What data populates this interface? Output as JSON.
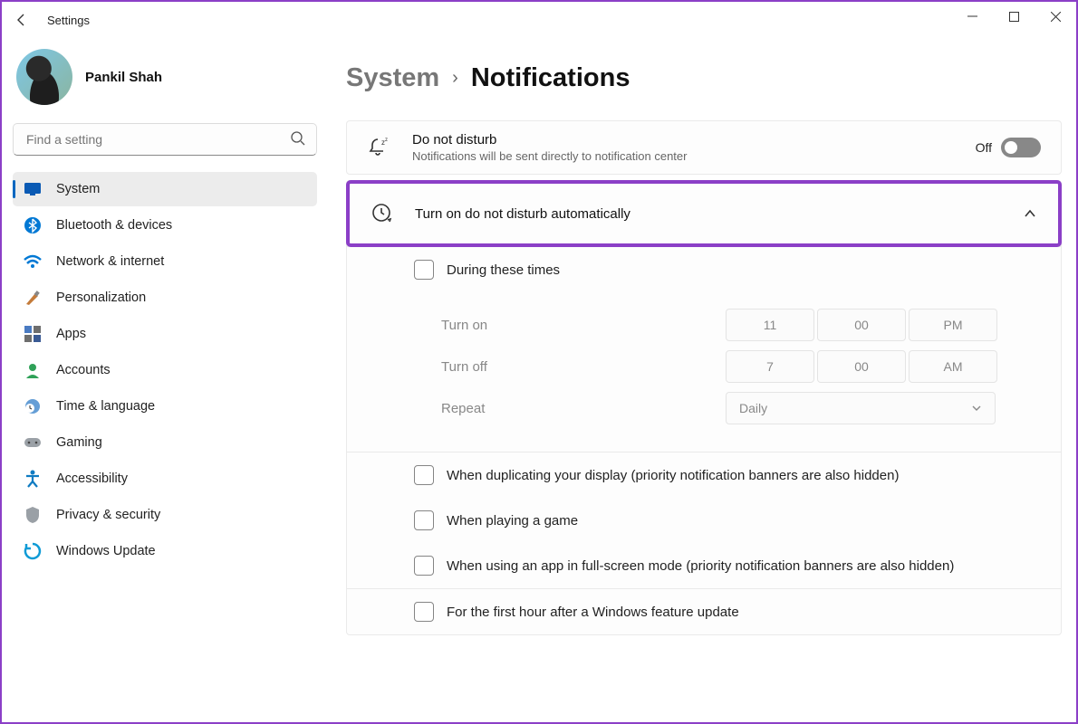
{
  "app_title": "Settings",
  "user_name": "Pankil Shah",
  "search_placeholder": "Find a setting",
  "sidebar": {
    "items": [
      {
        "label": "System"
      },
      {
        "label": "Bluetooth & devices"
      },
      {
        "label": "Network & internet"
      },
      {
        "label": "Personalization"
      },
      {
        "label": "Apps"
      },
      {
        "label": "Accounts"
      },
      {
        "label": "Time & language"
      },
      {
        "label": "Gaming"
      },
      {
        "label": "Accessibility"
      },
      {
        "label": "Privacy & security"
      },
      {
        "label": "Windows Update"
      }
    ]
  },
  "breadcrumb": {
    "parent": "System",
    "current": "Notifications"
  },
  "dnd": {
    "title": "Do not disturb",
    "sub": "Notifications will be sent directly to notification center",
    "toggle_label": "Off"
  },
  "auto": {
    "title": "Turn on do not disturb automatically",
    "during": "During these times",
    "turn_on": "Turn on",
    "turn_off": "Turn off",
    "repeat": "Repeat",
    "on_h": "11",
    "on_m": "00",
    "on_ampm": "PM",
    "off_h": "7",
    "off_m": "00",
    "off_ampm": "AM",
    "repeat_val": "Daily",
    "opt_duplicate": "When duplicating your display (priority notification banners are also hidden)",
    "opt_game": "When playing a game",
    "opt_fullscreen": "When using an app in full-screen mode (priority notification banners are also hidden)",
    "opt_featureupdate": "For the first hour after a Windows feature update"
  }
}
